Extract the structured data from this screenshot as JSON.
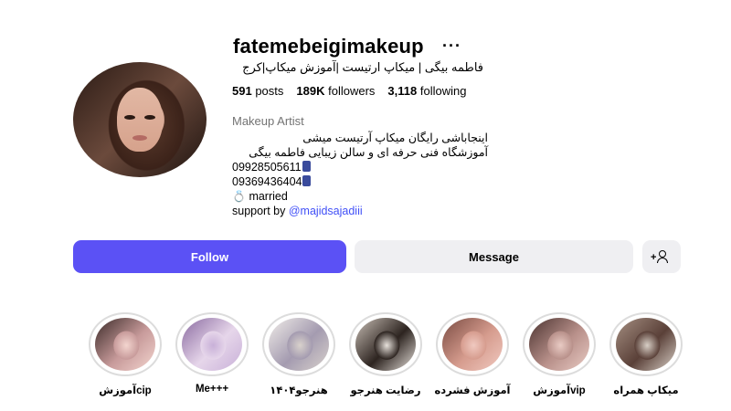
{
  "profile": {
    "username": "fatemebeigimakeup",
    "more": "···",
    "full_name": "فاطمه بیگی | میکاپ ارتیست |آموزش میکاپ|کرج",
    "stats": {
      "posts_count": "591",
      "posts_label": "posts",
      "followers_count": "189K",
      "followers_label": "followers",
      "following_count": "3,118",
      "following_label": "following"
    },
    "category": "Makeup Artist",
    "bio": {
      "line1": "اینجاباشی رایگان میکاپ آرتیست میشی",
      "line2": "آموزشگاه فنی حرفه ای و سالن زیبایی فاطمه بیگی",
      "phone1": "09928505611",
      "phone2": "09369436404",
      "married": "married",
      "support_prefix": "support by",
      "support_link": "@majidsajadiii"
    }
  },
  "actions": {
    "follow": "Follow",
    "message": "Message"
  },
  "highlights": [
    {
      "label": "آموزشcip",
      "colors": [
        "#f3d5cf",
        "#c79a9a",
        "#3a2a28"
      ]
    },
    {
      "label": "Me+++",
      "colors": [
        "#c8b0d8",
        "#e6d6ea",
        "#8a6aa0"
      ]
    },
    {
      "label": "هنرجو۱۴۰۴",
      "colors": [
        "#d9d2cc",
        "#a49bb0",
        "#f0ece8"
      ]
    },
    {
      "label": "رضایت هنرجو",
      "colors": [
        "#e8e2dc",
        "#2d2420",
        "#c9bfb6"
      ]
    },
    {
      "label": "آموزش فشرده",
      "colors": [
        "#f0c9c0",
        "#d69c8e",
        "#7a4b42"
      ]
    },
    {
      "label": "آموزش‌vip",
      "colors": [
        "#e9cbc4",
        "#b8908a",
        "#4b3330"
      ]
    },
    {
      "label": "میکاپ همراه",
      "colors": [
        "#d8cfc6",
        "#5a4038",
        "#a58f82"
      ]
    }
  ]
}
